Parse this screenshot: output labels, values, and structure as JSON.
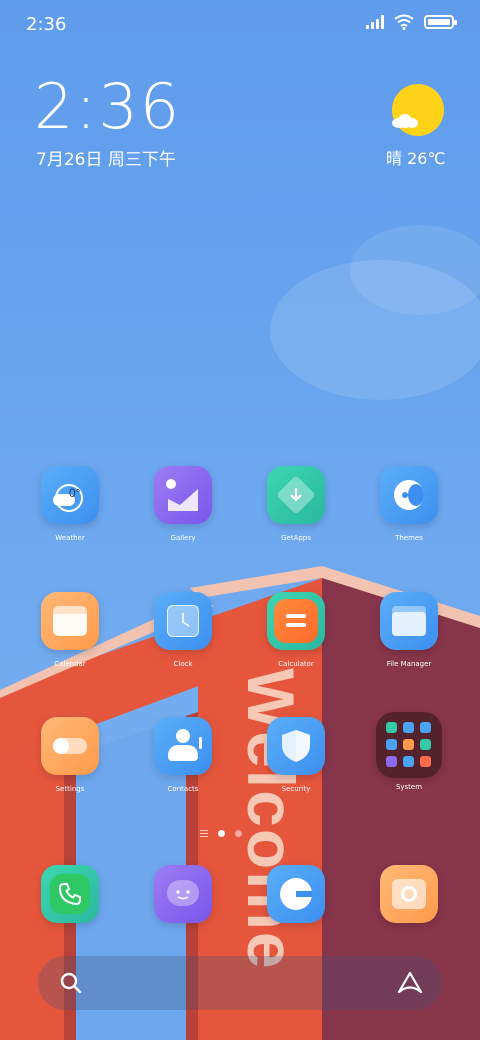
{
  "status_bar": {
    "time": "2:36",
    "battery_level": 1.0
  },
  "clock_widget": {
    "time": "2:36",
    "date": "7月26日 周三下午",
    "weather": "晴 26℃",
    "weather_icon": "sun-cloud-icon"
  },
  "wallpaper": {
    "text": "Welcome"
  },
  "apps": [
    {
      "label": "Weather",
      "icon": "weather-icon",
      "badge": "0°"
    },
    {
      "label": "Gallery",
      "icon": "gallery-icon"
    },
    {
      "label": "GetApps",
      "icon": "getapps-icon"
    },
    {
      "label": "Themes",
      "icon": "themes-icon"
    },
    {
      "label": "Calendar",
      "icon": "calendar-icon"
    },
    {
      "label": "Clock",
      "icon": "clock-icon"
    },
    {
      "label": "Calculator",
      "icon": "calculator-icon"
    },
    {
      "label": "File Manager",
      "icon": "file-manager-icon"
    },
    {
      "label": "Settings",
      "icon": "settings-icon"
    },
    {
      "label": "Contacts",
      "icon": "contacts-icon"
    },
    {
      "label": "Security",
      "icon": "security-icon"
    },
    {
      "label": "System",
      "icon": "system-folder-icon"
    }
  ],
  "dock": [
    {
      "icon": "phone-icon"
    },
    {
      "icon": "messages-icon"
    },
    {
      "icon": "browser-icon"
    },
    {
      "icon": "camera-icon"
    }
  ],
  "colors": {
    "sky": "#6aa5ee",
    "building_red": "#e5563d",
    "building_maroon": "#87354b",
    "sun": "#ffd21a"
  }
}
